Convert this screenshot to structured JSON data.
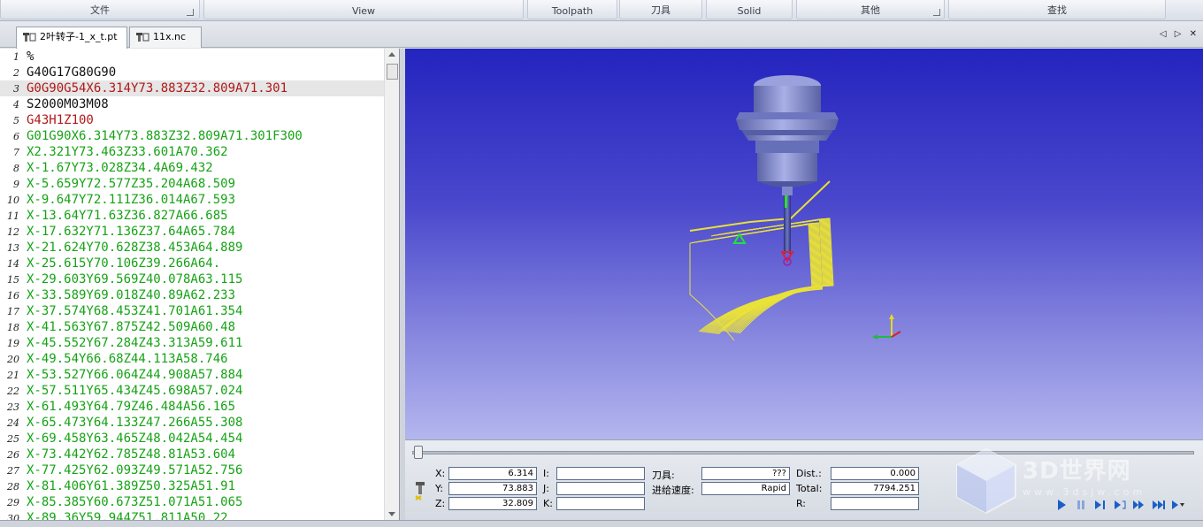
{
  "ribbon": {
    "groups": [
      {
        "label": "文件"
      },
      {
        "label": "View"
      },
      {
        "label": "Toolpath"
      },
      {
        "label": "刀具"
      },
      {
        "label": "Solid"
      },
      {
        "label": "其他"
      },
      {
        "label": "查找"
      }
    ]
  },
  "tabs": [
    {
      "label": "2叶转子-1_x_t.pt",
      "active": true
    },
    {
      "label": "11x.nc",
      "active": false
    }
  ],
  "tab_nav": "◁ ▷ ✕",
  "editor": {
    "lines": [
      {
        "n": "1",
        "text": "%",
        "color": "black"
      },
      {
        "n": "2",
        "text": "G40G17G80G90",
        "color": "black"
      },
      {
        "n": "3",
        "text": "G0G90G54X6.314Y73.883Z32.809A71.301",
        "color": "red"
      },
      {
        "n": "4",
        "text": "S2000M03M08",
        "color": "black"
      },
      {
        "n": "5",
        "text": "G43H1Z100",
        "color": "red"
      },
      {
        "n": "6",
        "text": "G01G90X6.314Y73.883Z32.809A71.301F300",
        "color": "green"
      },
      {
        "n": "7",
        "text": "X2.321Y73.463Z33.601A70.362",
        "color": "green"
      },
      {
        "n": "8",
        "text": "X-1.67Y73.028Z34.4A69.432",
        "color": "green"
      },
      {
        "n": "9",
        "text": "X-5.659Y72.577Z35.204A68.509",
        "color": "green"
      },
      {
        "n": "10",
        "text": "X-9.647Y72.111Z36.014A67.593",
        "color": "green"
      },
      {
        "n": "11",
        "text": "X-13.64Y71.63Z36.827A66.685",
        "color": "green"
      },
      {
        "n": "12",
        "text": "X-17.632Y71.136Z37.64A65.784",
        "color": "green"
      },
      {
        "n": "13",
        "text": "X-21.624Y70.628Z38.453A64.889",
        "color": "green"
      },
      {
        "n": "14",
        "text": "X-25.615Y70.106Z39.266A64.",
        "color": "green"
      },
      {
        "n": "15",
        "text": "X-29.603Y69.569Z40.078A63.115",
        "color": "green"
      },
      {
        "n": "16",
        "text": "X-33.589Y69.018Z40.89A62.233",
        "color": "green"
      },
      {
        "n": "17",
        "text": "X-37.574Y68.453Z41.701A61.354",
        "color": "green"
      },
      {
        "n": "18",
        "text": "X-41.563Y67.875Z42.509A60.48",
        "color": "green"
      },
      {
        "n": "19",
        "text": "X-45.552Y67.284Z43.313A59.611",
        "color": "green"
      },
      {
        "n": "20",
        "text": "X-49.54Y66.68Z44.113A58.746",
        "color": "green"
      },
      {
        "n": "21",
        "text": "X-53.527Y66.064Z44.908A57.884",
        "color": "green"
      },
      {
        "n": "22",
        "text": "X-57.511Y65.434Z45.698A57.024",
        "color": "green"
      },
      {
        "n": "23",
        "text": "X-61.493Y64.79Z46.484A56.165",
        "color": "green"
      },
      {
        "n": "24",
        "text": "X-65.473Y64.133Z47.266A55.308",
        "color": "green"
      },
      {
        "n": "25",
        "text": "X-69.458Y63.465Z48.042A54.454",
        "color": "green"
      },
      {
        "n": "26",
        "text": "X-73.442Y62.785Z48.81A53.604",
        "color": "green"
      },
      {
        "n": "27",
        "text": "X-77.425Y62.093Z49.571A52.756",
        "color": "green"
      },
      {
        "n": "28",
        "text": "X-81.406Y61.389Z50.325A51.91",
        "color": "green"
      },
      {
        "n": "29",
        "text": "X-85.385Y60.673Z51.071A51.065",
        "color": "green"
      },
      {
        "n": "30",
        "text": "X-89.36Y59.944Z51.811A50.22",
        "color": "green"
      }
    ]
  },
  "sim": {
    "x_label": "X:",
    "x_value": "6.314",
    "y_label": "Y:",
    "y_value": "73.883",
    "z_label": "Z:",
    "z_value": "32.809",
    "i_label": "I:",
    "i_value": "",
    "j_label": "J:",
    "j_value": "",
    "k_label": "K:",
    "k_value": "",
    "tool_label": "刀具:",
    "tool_value": "???",
    "feed_label": "进给速度:",
    "feed_value": "Rapid",
    "dist_label": "Dist.:",
    "dist_value": "0.000",
    "total_label": "Total:",
    "total_value": "7794.251",
    "r_label": "R:",
    "r_value": "",
    "progress": 0
  },
  "watermark": {
    "text": "3D世界网",
    "url": "www.3dsjw.com"
  },
  "colors": {
    "code_black": "#111111",
    "code_red": "#b01818",
    "code_green": "#16a316",
    "viewport_top": "#2424bf",
    "viewport_bottom": "#b4b6ee",
    "toolpath": "#f0e830",
    "tool_body": "#8c94cf"
  }
}
